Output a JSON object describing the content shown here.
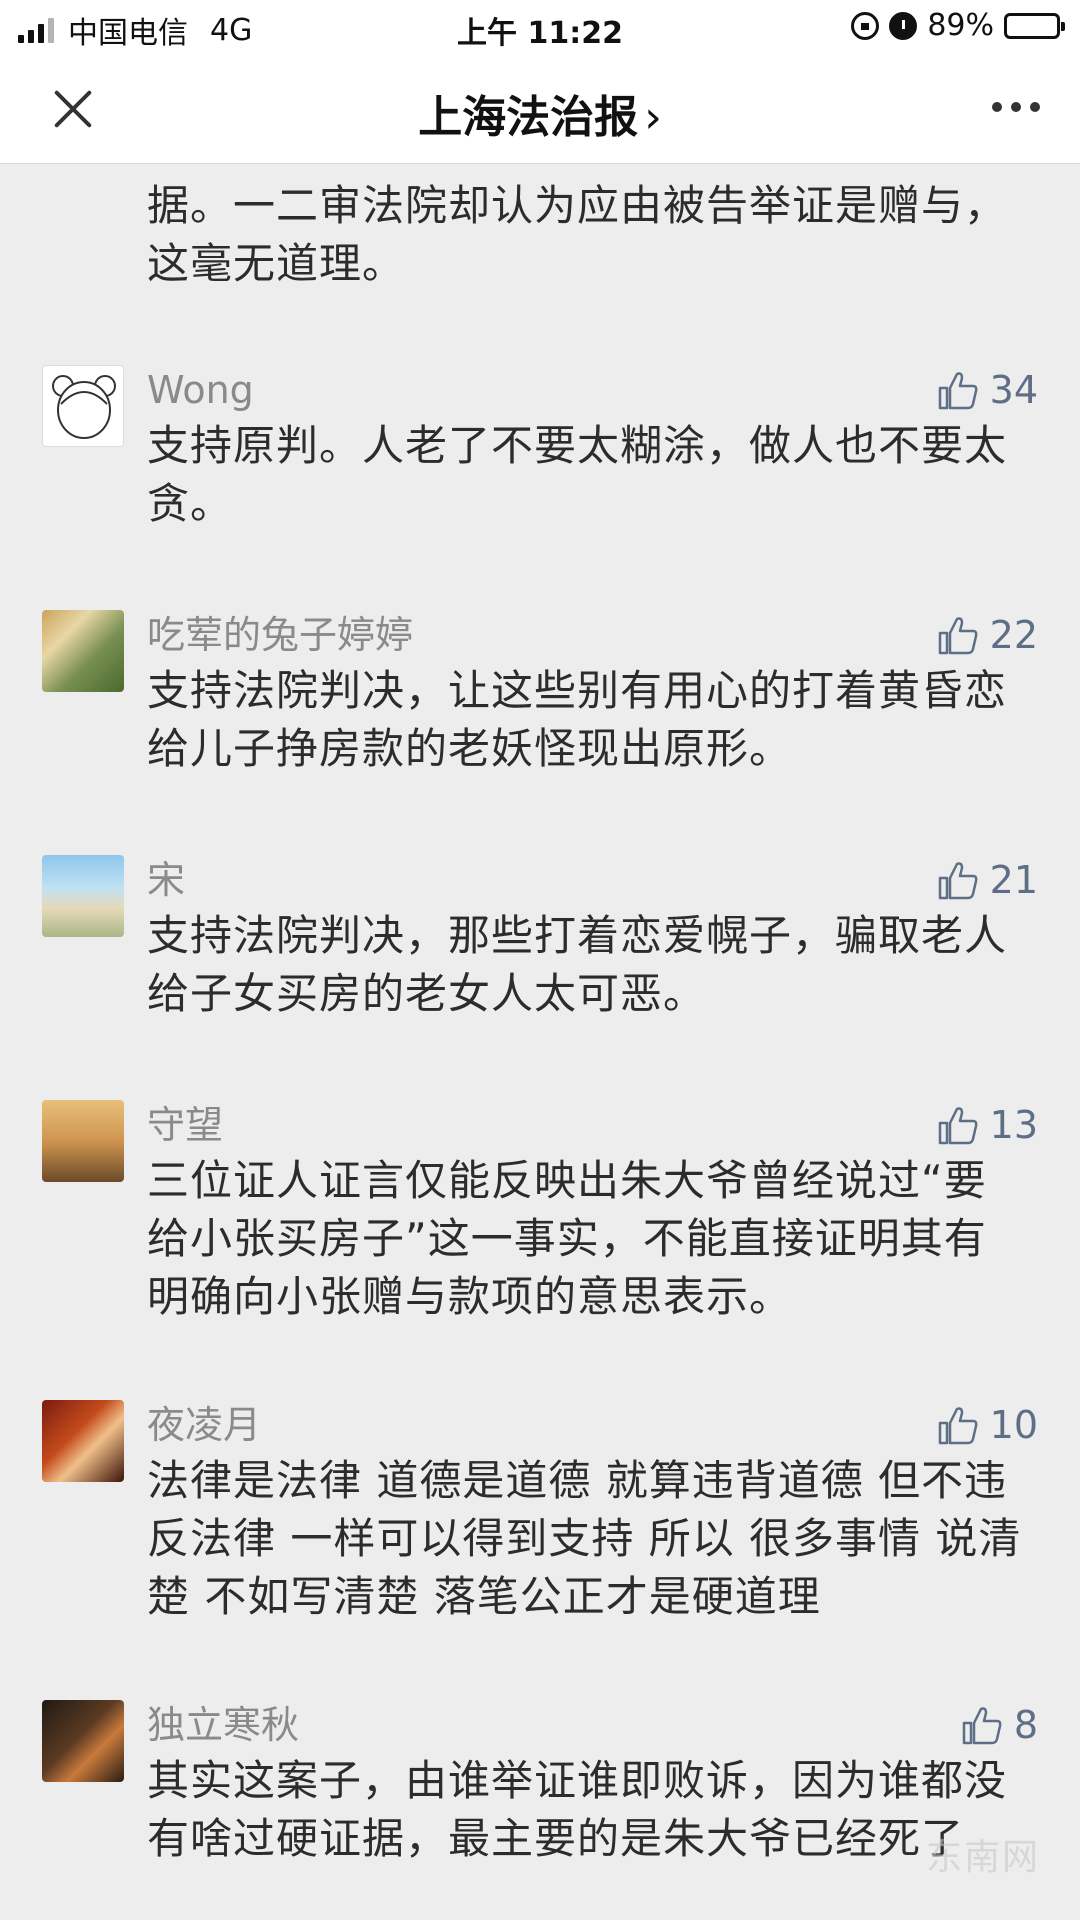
{
  "status_bar": {
    "carrier": "中国电信",
    "network": "4G",
    "time": "上午 11:22",
    "battery": "89%",
    "battery_level": 0.89
  },
  "nav": {
    "title": "上海法治报",
    "chevron": "›"
  },
  "previous_comment": {
    "text": "据。一二审法院却认为应由被告举证是赠与，这毫无道理。"
  },
  "comments": [
    {
      "name": "Wong",
      "likes": "34",
      "text": "支持原判。人老了不要太糊涂，做人也不要太贪。"
    },
    {
      "name": "吃荤的兔子婷婷",
      "likes": "22",
      "text": "支持法院判决，让这些别有用心的打着黄昏恋给儿子挣房款的老妖怪现出原形。"
    },
    {
      "name": "宋",
      "likes": "21",
      "text": "支持法院判决，那些打着恋爱幌子，骗取老人给子女买房的老女人太可恶。"
    },
    {
      "name": "守望",
      "likes": "13",
      "text": "三位证人证言仅能反映出朱大爷曾经说过“要给小张买房子”这一事实，不能直接证明其有明确向小张赠与款项的意思表示。"
    },
    {
      "name": "夜凌月",
      "likes": "10",
      "text": "法律是法律 道德是道德 就算违背道德 但不违反法律 一样可以得到支持 所以 很多事情 说清楚 不如写清楚 落笔公正才是硬道理"
    },
    {
      "name": "独立寒秋",
      "likes": "8",
      "text": "其实这案子，由谁举证谁即败诉，因为谁都没有啥过硬证据，最主要的是朱大爷已经死了"
    }
  ],
  "watermark": "东南网",
  "colors": {
    "background": "#ededed",
    "like_count": "#5d6e86",
    "username": "#8a8a8a"
  },
  "icons": {
    "close": "close-icon",
    "more": "more-icon",
    "like": "thumbs-up-icon"
  }
}
